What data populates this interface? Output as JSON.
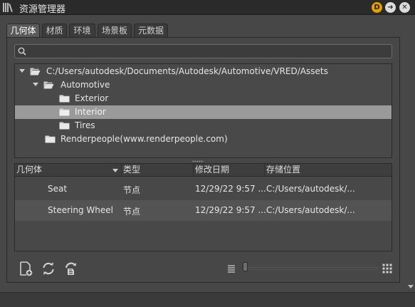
{
  "window": {
    "title": "资源管理器",
    "icons": [
      "library-icon",
      "d-badge-icon",
      "forward-icon",
      "close-icon"
    ]
  },
  "tabs": [
    {
      "label": "几何体",
      "active": true
    },
    {
      "label": "材质",
      "active": false
    },
    {
      "label": "环境",
      "active": false
    },
    {
      "label": "场景板",
      "active": false
    },
    {
      "label": "元数据",
      "active": false
    }
  ],
  "search": {
    "value": "",
    "placeholder": ""
  },
  "tree": [
    {
      "label": "C:/Users/autodesk/Documents/Autodesk/Automotive/VRED/Assets",
      "expanded": true,
      "level": 0
    },
    {
      "label": "Automotive",
      "expanded": true,
      "level": 1
    },
    {
      "label": "Exterior",
      "level": 2
    },
    {
      "label": "Interior",
      "level": 2,
      "selected": true
    },
    {
      "label": "Tires",
      "level": 2
    },
    {
      "label": "Renderpeople(www.renderpeople.com)",
      "level": 1
    }
  ],
  "grid": {
    "columns": [
      "几何体",
      "类型",
      "修改日期",
      "存储位置"
    ],
    "rows": [
      {
        "name": "Seat",
        "type": "节点",
        "modified": "12/29/22 9:57 ...",
        "location": "C:/Users/autodesk/..."
      },
      {
        "name": "Steering Wheel",
        "type": "节点",
        "modified": "12/29/22 9:57 ...",
        "location": "C:/Users/autodesk/..."
      }
    ]
  },
  "toolbar": {
    "icons": [
      "new-file-icon",
      "refresh-icon",
      "load-icon",
      "list-view-icon",
      "thumbnail-size-slider",
      "grid-view-icon"
    ],
    "thumbnail_size": 0
  },
  "colors": {
    "accent": "#e8a000",
    "selection": "#9a9a9a",
    "background": "#474747"
  }
}
